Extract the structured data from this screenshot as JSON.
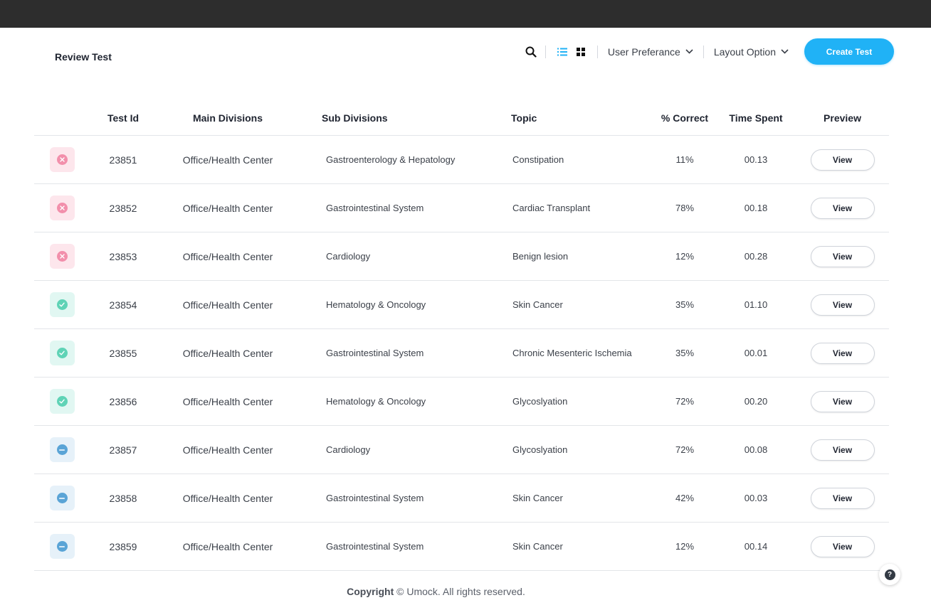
{
  "header": {
    "title": "Review Test",
    "search_icon": "search-icon",
    "list_view_icon": "list-view-icon",
    "grid_view_icon": "grid-view-icon",
    "user_preference_label": "User Preferance",
    "layout_option_label": "Layout Option",
    "create_button_label": "Create Test",
    "accent_color": "#20b2f6"
  },
  "table": {
    "columns": {
      "test_id": "Test Id",
      "main_divisions": "Main Divisions",
      "sub_divisions": "Sub Divisions",
      "topic": "Topic",
      "percent_correct": "% Correct",
      "time_spent": "Time Spent",
      "preview": "Preview"
    },
    "view_label": "View",
    "status_colors": {
      "fail": "#f28fab",
      "pass": "#5fd3b6",
      "skip": "#5aa4d6"
    },
    "rows": [
      {
        "status": "fail",
        "status_icon": "x-circle-icon",
        "id": "23851",
        "main": "Office/Health Center",
        "sub": "Gastroenterology & Hepatology",
        "topic": "Constipation",
        "pct": "11%",
        "time": "00.13"
      },
      {
        "status": "fail",
        "status_icon": "x-circle-icon",
        "id": "23852",
        "main": "Office/Health Center",
        "sub": "Gastrointestinal System",
        "topic": "Cardiac Transplant",
        "pct": "78%",
        "time": "00.18"
      },
      {
        "status": "fail",
        "status_icon": "x-circle-icon",
        "id": "23853",
        "main": "Office/Health Center",
        "sub": "Cardiology",
        "topic": "Benign lesion",
        "pct": "12%",
        "time": "00.28"
      },
      {
        "status": "pass",
        "status_icon": "check-circle-icon",
        "id": "23854",
        "main": "Office/Health Center",
        "sub": "Hematology & Oncology",
        "topic": "Skin Cancer",
        "pct": "35%",
        "time": "01.10"
      },
      {
        "status": "pass",
        "status_icon": "check-circle-icon",
        "id": "23855",
        "main": "Office/Health Center",
        "sub": "Gastrointestinal System",
        "topic": "Chronic Mesenteric Ischemia",
        "pct": "35%",
        "time": "00.01"
      },
      {
        "status": "pass",
        "status_icon": "check-circle-icon",
        "id": "23856",
        "main": "Office/Health Center",
        "sub": "Hematology & Oncology",
        "topic": "Glycoslyation",
        "pct": "72%",
        "time": "00.20"
      },
      {
        "status": "skip",
        "status_icon": "minus-circle-icon",
        "id": "23857",
        "main": "Office/Health Center",
        "sub": "Cardiology",
        "topic": "Glycoslyation",
        "pct": "72%",
        "time": "00.08"
      },
      {
        "status": "skip",
        "status_icon": "minus-circle-icon",
        "id": "23858",
        "main": "Office/Health Center",
        "sub": "Gastrointestinal System",
        "topic": "Skin Cancer",
        "pct": "42%",
        "time": "00.03"
      },
      {
        "status": "skip",
        "status_icon": "minus-circle-icon",
        "id": "23859",
        "main": "Office/Health Center",
        "sub": "Gastrointestinal System",
        "topic": "Skin Cancer",
        "pct": "12%",
        "time": "00.14"
      }
    ]
  },
  "footer": {
    "copyright_label": "Copyright",
    "copyright_text": "© Umock. All rights reserved."
  },
  "help": {
    "icon": "help-icon",
    "label": "?"
  }
}
